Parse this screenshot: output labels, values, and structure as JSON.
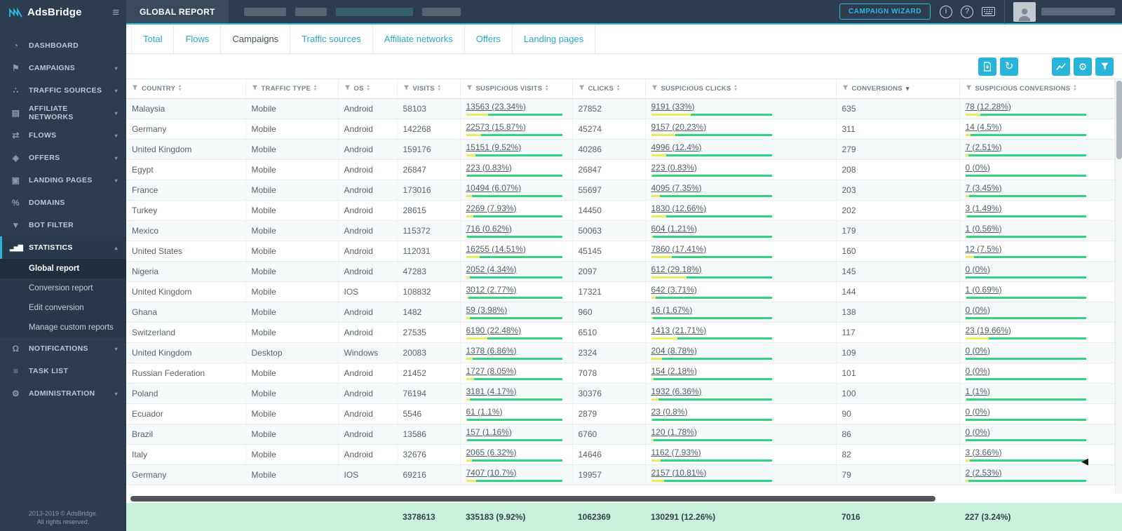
{
  "sidebar": {
    "logo_text": "AdsBridge",
    "items": [
      {
        "label": "DASHBOARD",
        "icon": "dashboard-icon"
      },
      {
        "label": "CAMPAIGNS",
        "icon": "campaigns-icon",
        "chevron": "down"
      },
      {
        "label": "TRAFFIC SOURCES",
        "icon": "traffic-sources-icon",
        "chevron": "down"
      },
      {
        "label": "AFFILIATE NETWORKS",
        "icon": "affiliate-networks-icon",
        "chevron": "down"
      },
      {
        "label": "FLOWS",
        "icon": "flows-icon",
        "chevron": "down"
      },
      {
        "label": "OFFERS",
        "icon": "offers-icon",
        "chevron": "down"
      },
      {
        "label": "LANDING PAGES",
        "icon": "landing-pages-icon",
        "chevron": "down"
      },
      {
        "label": "DOMAINS",
        "icon": "domains-icon"
      },
      {
        "label": "BOT FILTER",
        "icon": "bot-filter-icon"
      },
      {
        "label": "STATISTICS",
        "icon": "statistics-icon",
        "chevron": "up",
        "open": true,
        "subitems": [
          {
            "label": "Global report",
            "active": true
          },
          {
            "label": "Conversion report"
          },
          {
            "label": "Edit conversion"
          },
          {
            "label": "Manage custom reports"
          }
        ]
      },
      {
        "label": "NOTIFICATIONS",
        "icon": "notifications-icon",
        "chevron": "down"
      },
      {
        "label": "TASK LIST",
        "icon": "task-list-icon"
      },
      {
        "label": "ADMINISTRATION",
        "icon": "administration-icon",
        "chevron": "down"
      }
    ],
    "footer_line1": "2013-2019 © AdsBridge.",
    "footer_line2": "All rights reserved."
  },
  "topbar": {
    "title": "GLOBAL REPORT",
    "campaign_wizard_label": "CAMPAIGN WIZARD",
    "icons": [
      "info-icon",
      "help-icon",
      "keyboard-icon"
    ]
  },
  "tabs": {
    "items": [
      "Total",
      "Flows",
      "Campaigns",
      "Traffic sources",
      "Affiliate networks",
      "Offers",
      "Landing pages"
    ],
    "active": "Campaigns"
  },
  "toolbar": {
    "left_buttons": [
      "export-icon",
      "refresh-icon"
    ],
    "right_buttons": [
      "chart-icon",
      "settings-icon",
      "filter-icon"
    ]
  },
  "colors": {
    "accent_cyan": "#28b5d9",
    "bar_green": "#2fd382",
    "bar_yellow": "#e9ed5b",
    "totals_green": "#c8f1dc",
    "sidebar_bg": "#2d3c4e"
  },
  "table": {
    "columns": [
      {
        "label": "COUNTRY",
        "sort": "both"
      },
      {
        "label": "TRAFFIC TYPE",
        "sort": "both"
      },
      {
        "label": "OS",
        "sort": "both"
      },
      {
        "label": "VISITS",
        "sort": "both"
      },
      {
        "label": "SUSPICIOUS VISITS",
        "sort": "both"
      },
      {
        "label": "CLICKS",
        "sort": "both"
      },
      {
        "label": "SUSPICIOUS CLICKS",
        "sort": "both"
      },
      {
        "label": "CONVERSIONS",
        "sort": "desc"
      },
      {
        "label": "SUSPICIOUS CONVERSIONS",
        "sort": "both"
      }
    ],
    "rows": [
      {
        "country": "Malaysia",
        "traffic_type": "Mobile",
        "os": "Android",
        "visits": "58103",
        "suspicious_visits": {
          "label": "13563 (23.34%)",
          "pct": 23.34
        },
        "clicks": "27852",
        "suspicious_clicks": {
          "label": "9191 (33%)",
          "pct": 33
        },
        "conversions": "635",
        "suspicious_conversions": {
          "label": "78 (12.28%)",
          "pct": 12.28
        }
      },
      {
        "country": "Germany",
        "traffic_type": "Mobile",
        "os": "Android",
        "visits": "142268",
        "suspicious_visits": {
          "label": "22573 (15.87%)",
          "pct": 15.87
        },
        "clicks": "45274",
        "suspicious_clicks": {
          "label": "9157 (20.23%)",
          "pct": 20.23
        },
        "conversions": "311",
        "suspicious_conversions": {
          "label": "14 (4.5%)",
          "pct": 4.5
        }
      },
      {
        "country": "United Kingdom",
        "traffic_type": "Mobile",
        "os": "Android",
        "visits": "159176",
        "suspicious_visits": {
          "label": "15151 (9.52%)",
          "pct": 9.52
        },
        "clicks": "40286",
        "suspicious_clicks": {
          "label": "4996 (12.4%)",
          "pct": 12.4
        },
        "conversions": "279",
        "suspicious_conversions": {
          "label": "7 (2.51%)",
          "pct": 2.51
        }
      },
      {
        "country": "Egypt",
        "traffic_type": "Mobile",
        "os": "Android",
        "visits": "26847",
        "suspicious_visits": {
          "label": "223 (0.83%)",
          "pct": 0.83
        },
        "clicks": "26847",
        "suspicious_clicks": {
          "label": "223 (0.83%)",
          "pct": 0.83
        },
        "conversions": "208",
        "suspicious_conversions": {
          "label": "0 (0%)",
          "pct": 0
        }
      },
      {
        "country": "France",
        "traffic_type": "Mobile",
        "os": "Android",
        "visits": "173016",
        "suspicious_visits": {
          "label": "10494 (6.07%)",
          "pct": 6.07
        },
        "clicks": "55697",
        "suspicious_clicks": {
          "label": "4095 (7.35%)",
          "pct": 7.35
        },
        "conversions": "203",
        "suspicious_conversions": {
          "label": "7 (3.45%)",
          "pct": 3.45
        }
      },
      {
        "country": "Turkey",
        "traffic_type": "Mobile",
        "os": "Android",
        "visits": "28615",
        "suspicious_visits": {
          "label": "2269 (7.93%)",
          "pct": 7.93
        },
        "clicks": "14450",
        "suspicious_clicks": {
          "label": "1830 (12.66%)",
          "pct": 12.66
        },
        "conversions": "202",
        "suspicious_conversions": {
          "label": "3 (1.49%)",
          "pct": 1.49
        }
      },
      {
        "country": "Mexico",
        "traffic_type": "Mobile",
        "os": "Android",
        "visits": "115372",
        "suspicious_visits": {
          "label": "716 (0.62%)",
          "pct": 0.62
        },
        "clicks": "50063",
        "suspicious_clicks": {
          "label": "604 (1.21%)",
          "pct": 1.21
        },
        "conversions": "179",
        "suspicious_conversions": {
          "label": "1 (0.56%)",
          "pct": 0.56
        }
      },
      {
        "country": "United States",
        "traffic_type": "Mobile",
        "os": "Android",
        "visits": "112031",
        "suspicious_visits": {
          "label": "16255 (14.51%)",
          "pct": 14.51
        },
        "clicks": "45145",
        "suspicious_clicks": {
          "label": "7860 (17.41%)",
          "pct": 17.41
        },
        "conversions": "160",
        "suspicious_conversions": {
          "label": "12 (7.5%)",
          "pct": 7.5
        }
      },
      {
        "country": "Nigeria",
        "traffic_type": "Mobile",
        "os": "Android",
        "visits": "47283",
        "suspicious_visits": {
          "label": "2052 (4.34%)",
          "pct": 4.34
        },
        "clicks": "2097",
        "suspicious_clicks": {
          "label": "612 (29.18%)",
          "pct": 29.18
        },
        "conversions": "145",
        "suspicious_conversions": {
          "label": "0 (0%)",
          "pct": 0
        }
      },
      {
        "country": "United Kingdom",
        "traffic_type": "Mobile",
        "os": "IOS",
        "visits": "108832",
        "suspicious_visits": {
          "label": "3012 (2.77%)",
          "pct": 2.77
        },
        "clicks": "17321",
        "suspicious_clicks": {
          "label": "642 (3.71%)",
          "pct": 3.71
        },
        "conversions": "144",
        "suspicious_conversions": {
          "label": "1 (0.69%)",
          "pct": 0.69
        }
      },
      {
        "country": "Ghana",
        "traffic_type": "Mobile",
        "os": "Android",
        "visits": "1482",
        "suspicious_visits": {
          "label": "59 (3.98%)",
          "pct": 3.98
        },
        "clicks": "960",
        "suspicious_clicks": {
          "label": "16 (1.67%)",
          "pct": 1.67
        },
        "conversions": "138",
        "suspicious_conversions": {
          "label": "0 (0%)",
          "pct": 0
        }
      },
      {
        "country": "Switzerland",
        "traffic_type": "Mobile",
        "os": "Android",
        "visits": "27535",
        "suspicious_visits": {
          "label": "6190 (22.48%)",
          "pct": 22.48
        },
        "clicks": "6510",
        "suspicious_clicks": {
          "label": "1413 (21.71%)",
          "pct": 21.71
        },
        "conversions": "117",
        "suspicious_conversions": {
          "label": "23 (19.66%)",
          "pct": 19.66
        }
      },
      {
        "country": "United Kingdom",
        "traffic_type": "Desktop",
        "os": "Windows",
        "visits": "20083",
        "suspicious_visits": {
          "label": "1378 (6.86%)",
          "pct": 6.86
        },
        "clicks": "2324",
        "suspicious_clicks": {
          "label": "204 (8.78%)",
          "pct": 8.78
        },
        "conversions": "109",
        "suspicious_conversions": {
          "label": "0 (0%)",
          "pct": 0
        }
      },
      {
        "country": "Russian Federation",
        "traffic_type": "Mobile",
        "os": "Android",
        "visits": "21452",
        "suspicious_visits": {
          "label": "1727 (8.05%)",
          "pct": 8.05
        },
        "clicks": "7078",
        "suspicious_clicks": {
          "label": "154 (2.18%)",
          "pct": 2.18
        },
        "conversions": "101",
        "suspicious_conversions": {
          "label": "0 (0%)",
          "pct": 0
        }
      },
      {
        "country": "Poland",
        "traffic_type": "Mobile",
        "os": "Android",
        "visits": "76194",
        "suspicious_visits": {
          "label": "3181 (4.17%)",
          "pct": 4.17
        },
        "clicks": "30376",
        "suspicious_clicks": {
          "label": "1932 (6.36%)",
          "pct": 6.36
        },
        "conversions": "100",
        "suspicious_conversions": {
          "label": "1 (1%)",
          "pct": 1
        }
      },
      {
        "country": "Ecuador",
        "traffic_type": "Mobile",
        "os": "Android",
        "visits": "5546",
        "suspicious_visits": {
          "label": "61 (1.1%)",
          "pct": 1.1
        },
        "clicks": "2879",
        "suspicious_clicks": {
          "label": "23 (0.8%)",
          "pct": 0.8
        },
        "conversions": "90",
        "suspicious_conversions": {
          "label": "0 (0%)",
          "pct": 0
        }
      },
      {
        "country": "Brazil",
        "traffic_type": "Mobile",
        "os": "Android",
        "visits": "13586",
        "suspicious_visits": {
          "label": "157 (1.16%)",
          "pct": 1.16
        },
        "clicks": "6760",
        "suspicious_clicks": {
          "label": "120 (1.78%)",
          "pct": 1.78
        },
        "conversions": "86",
        "suspicious_conversions": {
          "label": "0 (0%)",
          "pct": 0
        }
      },
      {
        "country": "Italy",
        "traffic_type": "Mobile",
        "os": "Android",
        "visits": "32676",
        "suspicious_visits": {
          "label": "2065 (6.32%)",
          "pct": 6.32
        },
        "clicks": "14646",
        "suspicious_clicks": {
          "label": "1162 (7.93%)",
          "pct": 7.93
        },
        "conversions": "82",
        "suspicious_conversions": {
          "label": "3 (3.66%)",
          "pct": 3.66
        }
      },
      {
        "country": "Germany",
        "traffic_type": "Mobile",
        "os": "IOS",
        "visits": "69216",
        "suspicious_visits": {
          "label": "7407 (10.7%)",
          "pct": 10.7
        },
        "clicks": "19957",
        "suspicious_clicks": {
          "label": "2157 (10.81%)",
          "pct": 10.81
        },
        "conversions": "79",
        "suspicious_conversions": {
          "label": "2 (2.53%)",
          "pct": 2.53
        }
      }
    ],
    "totals": {
      "visits": "3378613",
      "suspicious_visits": "335183 (9.92%)",
      "clicks": "1062369",
      "suspicious_clicks": "130291 (12.26%)",
      "conversions": "7016",
      "suspicious_conversions": "227 (3.24%)"
    }
  }
}
